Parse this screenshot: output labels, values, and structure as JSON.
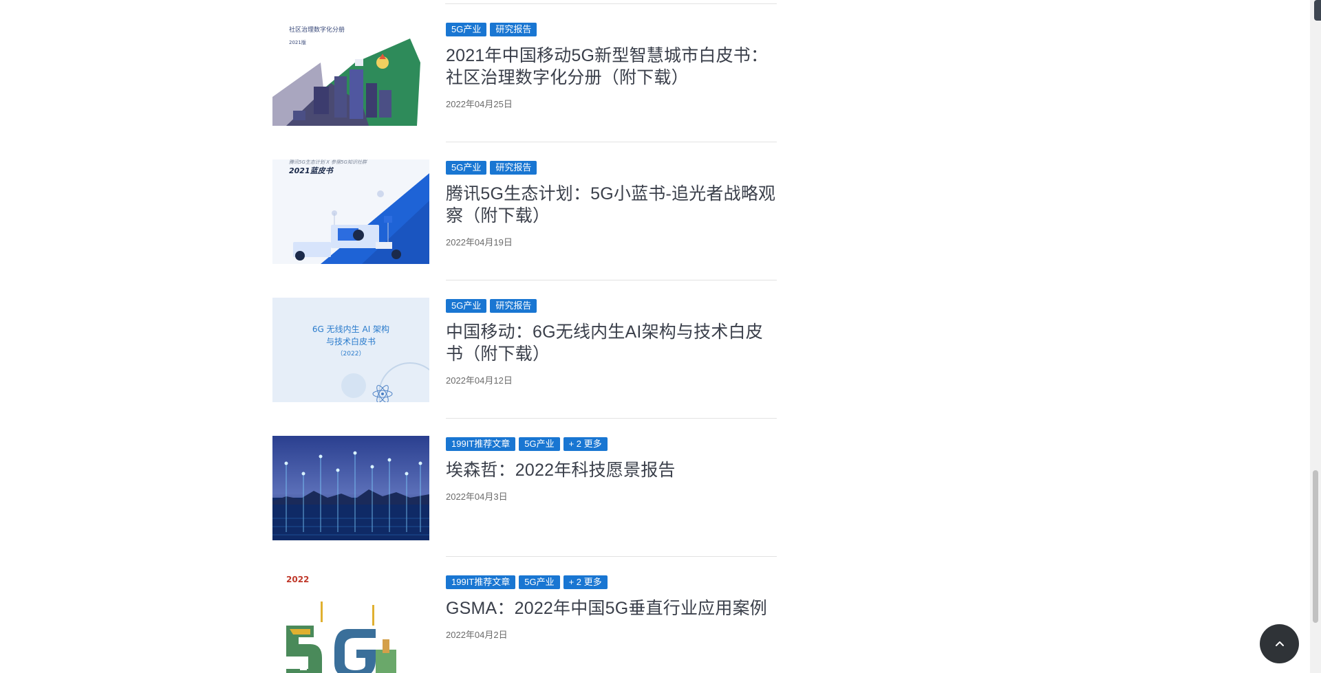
{
  "articles": [
    {
      "tags": [
        "5G产业",
        "研究报告"
      ],
      "title": "2021年中国移动5G新型智慧城市白皮书：社区治理数字化分册（附下载）",
      "date": "2022年04月25日",
      "thumb": {
        "line1": "社区治理数字化分册",
        "line2": "2021版"
      }
    },
    {
      "tags": [
        "5G产业",
        "研究报告"
      ],
      "title": "腾讯5G生态计划：5G小蓝书-追光者战略观察（附下载）",
      "date": "2022年04月19日",
      "thumb": {
        "line1": "腾讯5G生态计划 X 参宿5G知识社群",
        "line2": "2021蓝皮书"
      }
    },
    {
      "tags": [
        "5G产业",
        "研究报告"
      ],
      "title": "中国移动：6G无线内生AI架构与技术白皮书（附下载）",
      "date": "2022年04月12日",
      "thumb": {
        "line1": "6G 无线内生 AI 架构",
        "line2": "与技术白皮书",
        "line3": "（2022）"
      }
    },
    {
      "tags": [
        "199IT推荐文章",
        "5G产业",
        "+ 2 更多"
      ],
      "title": "埃森哲：2022年科技愿景报告",
      "date": "2022年04月3日"
    },
    {
      "tags": [
        "199IT推荐文章",
        "5G产业",
        "+ 2 更多"
      ],
      "title": "GSMA：2022年中国5G垂直行业应用案例",
      "date": "2022年04月2日",
      "thumb": {
        "line1": "2022"
      }
    }
  ],
  "colors": {
    "tag_bg": "#1976d2",
    "title": "#3a3f4a",
    "date": "#6a6a6a",
    "scroll_top_bg": "#2f3337"
  },
  "icons": {
    "scroll_top": "chevron-up-icon"
  }
}
